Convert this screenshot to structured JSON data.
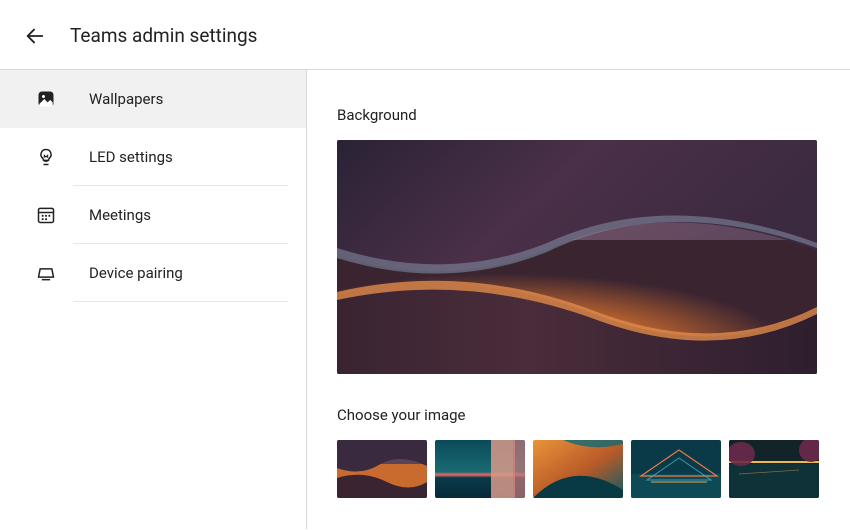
{
  "header": {
    "title": "Teams admin settings"
  },
  "sidebar": {
    "items": [
      {
        "label": "Wallpapers",
        "icon": "image-icon",
        "active": true
      },
      {
        "label": "LED settings",
        "icon": "bulb-icon",
        "active": false
      },
      {
        "label": "Meetings",
        "icon": "calendar-icon",
        "active": false
      },
      {
        "label": "Device pairing",
        "icon": "device-icon",
        "active": false
      }
    ]
  },
  "content": {
    "background_label": "Background",
    "choose_label": "Choose your image",
    "thumbnails": [
      {
        "name": "wave-purple"
      },
      {
        "name": "sunset-sea"
      },
      {
        "name": "wave-orange"
      },
      {
        "name": "glass-night"
      },
      {
        "name": "pool-night"
      }
    ]
  }
}
